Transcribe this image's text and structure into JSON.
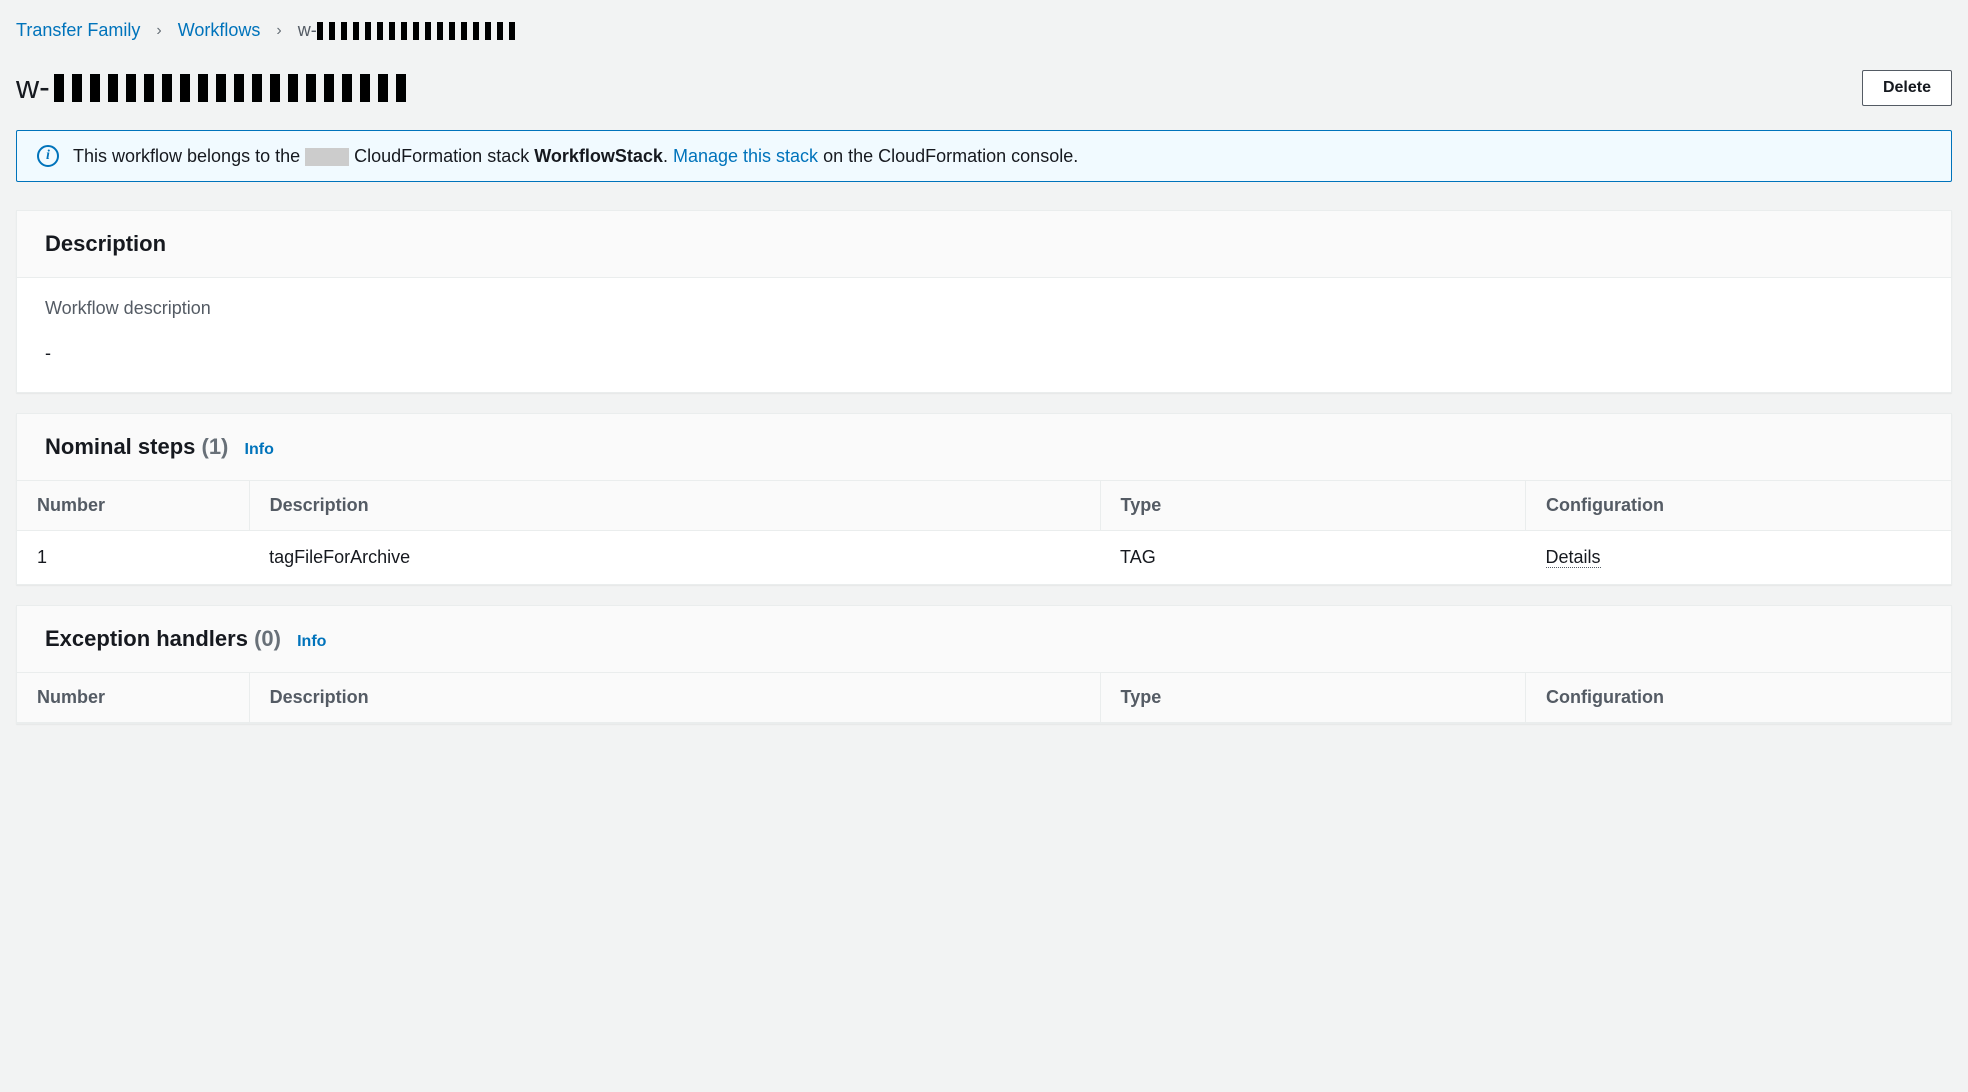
{
  "breadcrumb": {
    "root": "Transfer Family",
    "section": "Workflows",
    "current_prefix": "w-"
  },
  "page": {
    "title_prefix": "w-",
    "delete_label": "Delete"
  },
  "banner": {
    "prefix": "This workflow belongs to the",
    "mid": "CloudFormation stack",
    "stack_name": "WorkflowStack",
    "link": "Manage this stack",
    "suffix": "on the CloudFormation console."
  },
  "description_panel": {
    "heading": "Description",
    "field_label": "Workflow description",
    "value": "-"
  },
  "nominal": {
    "heading": "Nominal steps",
    "count": "(1)",
    "info": "Info",
    "columns": {
      "number": "Number",
      "description": "Description",
      "type": "Type",
      "configuration": "Configuration"
    },
    "rows": [
      {
        "number": "1",
        "description": "tagFileForArchive",
        "type": "TAG",
        "configuration": "Details"
      }
    ]
  },
  "exception": {
    "heading": "Exception handlers",
    "count": "(0)",
    "info": "Info",
    "columns": {
      "number": "Number",
      "description": "Description",
      "type": "Type",
      "configuration": "Configuration"
    }
  }
}
